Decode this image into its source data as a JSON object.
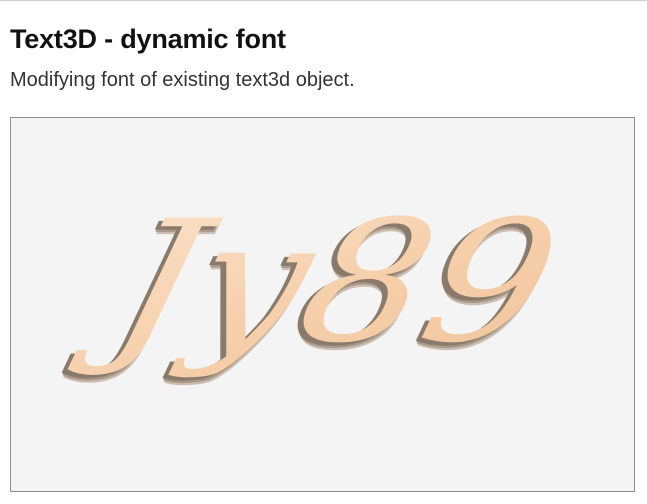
{
  "page": {
    "title": "Text3D - dynamic font",
    "subtitle": "Modifying font of existing text3d object."
  },
  "scene": {
    "text3d": "Jy89",
    "colors": {
      "face": "#f6cfab",
      "highlight": "#fbe3cc",
      "extrusion": "#8a7a6c",
      "background": "#f4f4f4",
      "border": "#8d8d8d"
    }
  }
}
